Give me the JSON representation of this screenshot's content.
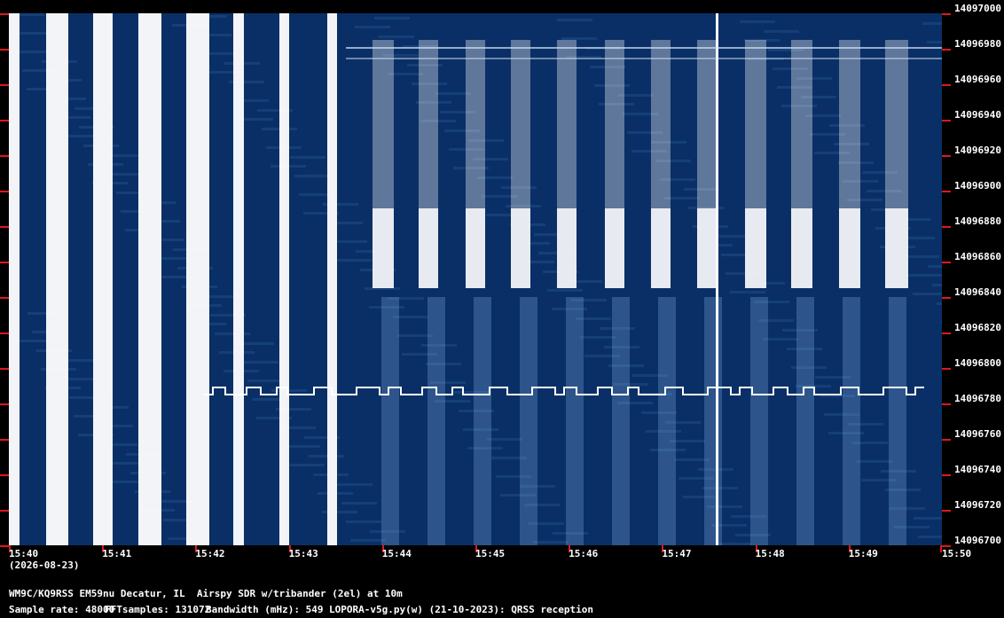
{
  "frequency_labels": [
    "14097000",
    "14096980",
    "14096960",
    "14096940",
    "14096920",
    "14096900",
    "14096880",
    "14096860",
    "14096840",
    "14096820",
    "14096800",
    "14096780",
    "14096760",
    "14096740",
    "14096720",
    "14096700"
  ],
  "time_labels": [
    "15:40",
    "15:41",
    "15:42",
    "15:43",
    "15:44",
    "15:45",
    "15:46",
    "15:47",
    "15:48",
    "15:49",
    "15:50"
  ],
  "date_label": "(2026-08-23)",
  "station_line": "WM9C/KQ9RSS EM59nu Decatur, IL  Airspy SDR w/tribander (2el) at 10m",
  "info": {
    "sample_rate": "Sample rate: 48000",
    "fft_samples": "FFTsamples: 131072",
    "bandwidth": "Bandwidth (mHz): 549",
    "software": "LOPORA-v5g.py(w) (21-10-2023): QRSS reception"
  },
  "colors": {
    "background": "#000000",
    "waterfall_base": "#0a2f66",
    "signal": "#ffffff",
    "tick": "#e01818"
  }
}
